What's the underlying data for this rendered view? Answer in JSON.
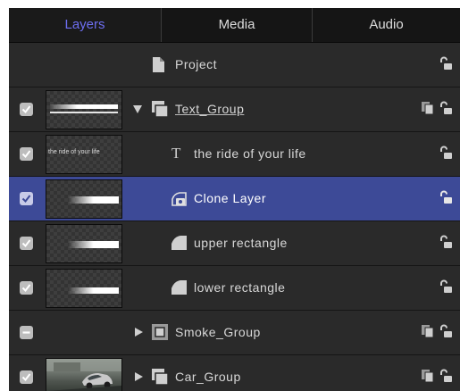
{
  "tabs": [
    "Layers",
    "Media",
    "Audio"
  ],
  "rows": [
    {
      "label": "Project"
    },
    {
      "label": "Text_Group"
    },
    {
      "label": "the ride of your life",
      "thumb_text": "the ride of your life"
    },
    {
      "label": "Clone Layer"
    },
    {
      "label": "upper rectangle"
    },
    {
      "label": "lower rectangle"
    },
    {
      "label": "Smoke_Group"
    },
    {
      "label": "Car_Group"
    }
  ],
  "colors": {
    "accent": "#6d6ef0",
    "selected_row": "#3d4a97",
    "panel": "#2a2a2a"
  }
}
